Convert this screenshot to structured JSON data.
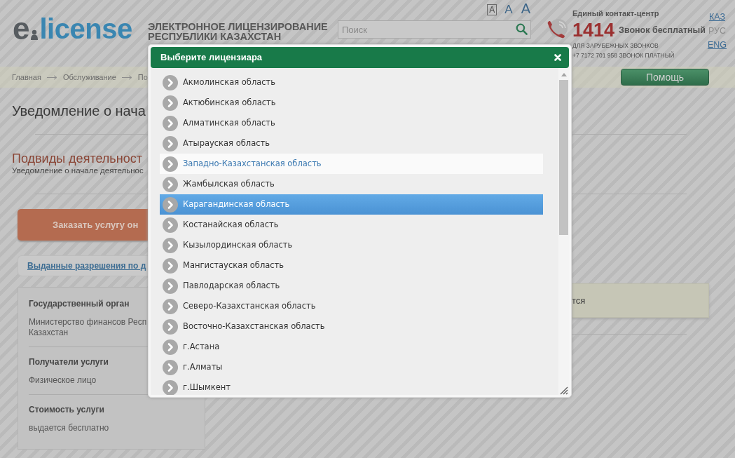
{
  "header": {
    "logo": {
      "prefix": "e",
      "name": "license"
    },
    "title_lines": [
      "ЭЛЕКТРОННОЕ ЛИЦЕНЗИРОВАНИЕ",
      "РЕСПУБЛИКИ КАЗАХСТАН"
    ],
    "font_sizes": [
      {
        "label": "A",
        "selected": true
      },
      {
        "label": "A",
        "selected": false
      },
      {
        "label": "A",
        "selected": false
      }
    ],
    "search": {
      "placeholder": "Поиск"
    },
    "contact": {
      "title": "Единый контакт-центр",
      "number": "1414",
      "number_note": "Звонок бесплатный",
      "foreign_label": "ДЛЯ ЗАРУБЕЖНЫХ ЗВОНКОВ",
      "foreign_number": "+7 7172 701 958 ЗВОНОК ПЛАТНЫЙ"
    },
    "languages": [
      {
        "label": "КАЗ",
        "selected": false
      },
      {
        "label": "РУС",
        "selected": true
      },
      {
        "label": "ENG",
        "selected": false
      }
    ]
  },
  "breadcrumb": {
    "items": [
      "Главная",
      "Обслуживание",
      "По"
    ],
    "help_button": "Помощь"
  },
  "page": {
    "title": "Уведомление о нача",
    "subtypes_title": "Подвиды деятельност",
    "subtypes_text": "Уведомление о начале деятельнос",
    "order_button": "Заказать услугу он",
    "permits_link": "Выданные разрешения по д",
    "info": [
      {
        "label": "Государственный орган",
        "value_lines": [
          "Министерство финансов Респ",
          "Казахстан"
        ]
      },
      {
        "label": "Получатели услуги",
        "value_lines": [
          "Физическое лицо"
        ]
      },
      {
        "label": "Стоимость услуги",
        "value_lines": [
          "выдается бесплатно"
        ]
      }
    ],
    "notice": "тся"
  },
  "dialog": {
    "title": "Выберите лицензиара",
    "items": [
      {
        "label": "Акмолинская область",
        "selected": false,
        "hovered": false
      },
      {
        "label": "Актюбинская область",
        "selected": false,
        "hovered": false
      },
      {
        "label": "Алматинская область",
        "selected": false,
        "hovered": false
      },
      {
        "label": "Атырауская область",
        "selected": false,
        "hovered": false
      },
      {
        "label": "Западно-Казахстанская область",
        "selected": false,
        "hovered": true
      },
      {
        "label": "Жамбылская область",
        "selected": false,
        "hovered": false
      },
      {
        "label": "Карагандинская область",
        "selected": true,
        "hovered": false
      },
      {
        "label": "Костанайская область",
        "selected": false,
        "hovered": false
      },
      {
        "label": "Кызылординская область",
        "selected": false,
        "hovered": false
      },
      {
        "label": "Мангистауская область",
        "selected": false,
        "hovered": false
      },
      {
        "label": "Павлодарская область",
        "selected": false,
        "hovered": false
      },
      {
        "label": "Северо-Казахстанская область",
        "selected": false,
        "hovered": false
      },
      {
        "label": "Восточно-Казахстанская область",
        "selected": false,
        "hovered": false
      },
      {
        "label": "г.Астана",
        "selected": false,
        "hovered": false
      },
      {
        "label": "г.Алматы",
        "selected": false,
        "hovered": false
      },
      {
        "label": "г.Шымкент",
        "selected": false,
        "hovered": false
      }
    ]
  }
}
